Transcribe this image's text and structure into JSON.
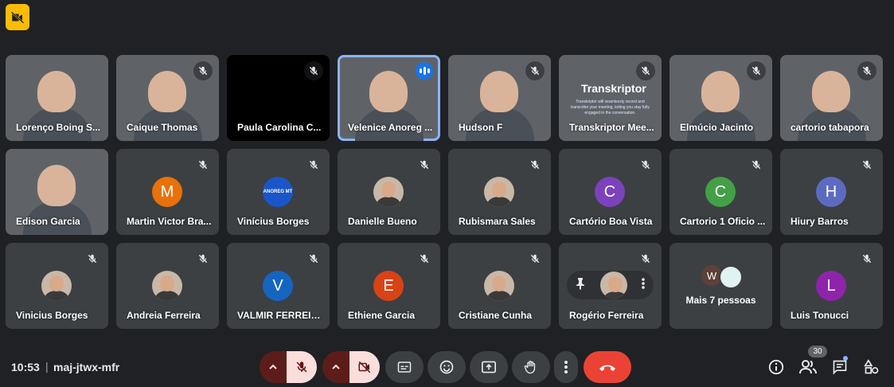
{
  "tiles": [
    {
      "name": "Lorenço Boing S...",
      "kind": "video",
      "bg": "bg1"
    },
    {
      "name": "Caique Thomas",
      "kind": "video",
      "bg": "bg2",
      "muted": true
    },
    {
      "name": "Paula Carolina C...",
      "kind": "black",
      "muted": true
    },
    {
      "name": "Velenice Anoreg ...",
      "kind": "video",
      "bg": "bg4",
      "active": true
    },
    {
      "name": "Hudson F",
      "kind": "video",
      "bg": "bg5",
      "muted": true
    },
    {
      "name": "Transkriptor Mee...",
      "kind": "transkriptor",
      "bg": "bg6",
      "muted": true,
      "logo": "Transkriptor",
      "promo": "Transkriptor will seamlessly record and transcribe your meeting, letting you stay fully engaged in the conversation."
    },
    {
      "name": "Elmúcio Jacinto",
      "kind": "video",
      "bg": "bg7",
      "muted": true
    },
    {
      "name": "cartorio tabapora",
      "kind": "video",
      "bg": "bg8",
      "muted": true
    },
    {
      "name": "Edison Garcia",
      "kind": "video",
      "bg": "bg9"
    },
    {
      "name": "Martin Victor Bra...",
      "kind": "letter",
      "letter": "M",
      "color": "#e8710a",
      "muted": true
    },
    {
      "name": "Vinícius Borges",
      "kind": "logo",
      "logo_text": "ANOREG MT",
      "color": "#1a56c9",
      "muted": true
    },
    {
      "name": "Danielle Bueno",
      "kind": "photo",
      "muted": true
    },
    {
      "name": "Rubismara Sales",
      "kind": "photo",
      "muted": true
    },
    {
      "name": "Cartório Boa Vista",
      "kind": "letter",
      "letter": "C",
      "color": "#7b42bc",
      "muted": true
    },
    {
      "name": "Cartorio 1 Oficio ...",
      "kind": "letter",
      "letter": "C",
      "color": "#43a047",
      "muted": true
    },
    {
      "name": "Hiury Barros",
      "kind": "letter",
      "letter": "H",
      "color": "#5c6bc0",
      "muted": true
    },
    {
      "name": "Vinicius Borges",
      "kind": "photo",
      "muted": true
    },
    {
      "name": "Andreia Ferreira",
      "kind": "photo",
      "muted": true
    },
    {
      "name": "VALMIR FERREIR...",
      "kind": "letter",
      "letter": "V",
      "color": "#1565c0",
      "muted": true
    },
    {
      "name": "Ethiene Garcia",
      "kind": "letter",
      "letter": "E",
      "color": "#d84315",
      "muted": true
    },
    {
      "name": "Cristiane Cunha",
      "kind": "photo",
      "muted": true
    },
    {
      "name": "Rogério Ferreira",
      "kind": "pinned",
      "muted": true
    },
    {
      "kind": "more",
      "label": "Mais 7 pessoas",
      "mini_letter": "W"
    },
    {
      "name": "Luis Tonucci",
      "kind": "letter",
      "letter": "L",
      "color": "#8e24aa",
      "muted": true
    }
  ],
  "bottom": {
    "time": "10:53",
    "separator": "|",
    "meeting_code": "maj-jtwx-mfr",
    "participants_count": "30"
  },
  "colors": {
    "background": "#202124",
    "end_call": "#ea4335",
    "accent": "#8ab4f8",
    "warning": "#fbbc04"
  }
}
